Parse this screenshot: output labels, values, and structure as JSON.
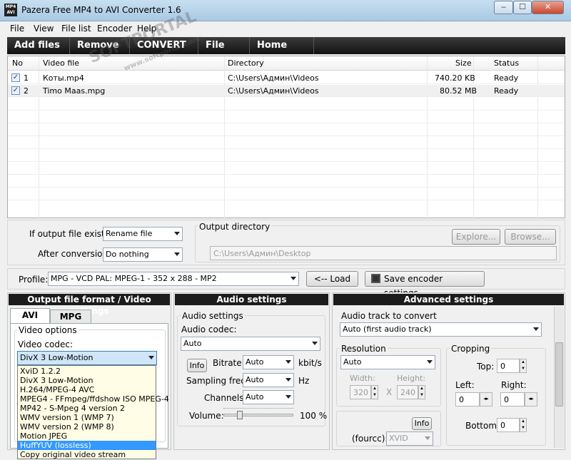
{
  "window": {
    "title": "Pazera Free MP4 to AVI Converter 1.6",
    "icon_text": "MP4 AVI",
    "controls": {
      "minimize": "–",
      "maximize": "☐",
      "close": "✕"
    }
  },
  "menu": [
    "File",
    "View",
    "File list",
    "Encoder",
    "Help"
  ],
  "toolbar": [
    "Add files",
    "Remove",
    "CONVERT",
    "File info",
    "Home page"
  ],
  "file_list": {
    "columns": [
      "No",
      "Video file",
      "Directory",
      "Size",
      "Status"
    ],
    "rows": [
      {
        "no": "1",
        "file": "Коты.mp4",
        "dir": "C:\\Users\\Админ\\Videos",
        "size": "740.20 KB",
        "status": "Ready",
        "checked": "✓"
      },
      {
        "no": "2",
        "file": "Timo Maas.mpg",
        "dir": "C:\\Users\\Админ\\Videos",
        "size": "80.52 MB",
        "status": "Ready",
        "checked": "✓"
      }
    ]
  },
  "options": {
    "if_exists_label": "If output file exists:",
    "if_exists_value": "Rename file",
    "after_conversion_label": "After conversion:",
    "after_conversion_value": "Do nothing",
    "output_dir_label": "Output directory",
    "output_dir_value": "C:\\Users\\Админ\\Desktop",
    "explore_label": "Explore...",
    "browse_label": "Browse..."
  },
  "profile": {
    "label": "Profile:",
    "value": "MPG - VCD PAL: MPEG-1 - 352 x 288 - MP2",
    "load_label": "<-- Load",
    "save_label": "Save encoder settings..."
  },
  "video_panel": {
    "header": "Output file format / Video settings",
    "tabs": [
      "AVI",
      "MPG"
    ],
    "group_label": "Video options",
    "codec_label": "Video codec:",
    "codec_value": "DivX 3 Low-Motion",
    "codec_options": [
      "XviD 1.2.2",
      "DivX 3 Low-Motion",
      "H.264/MPEG-4 AVC",
      "MPEG4 - FFmpeg/ffdshow ISO MPEG-4",
      "MP42 - S-Mpeg 4 version 2",
      "WMV version 1 (WMP 7)",
      "WMV version 2 (WMP 8)",
      "Motion JPEG",
      "HuffYUV (lossless)",
      "Copy original video stream"
    ],
    "highlighted_option": "HuffYUV (lossless)"
  },
  "audio_panel": {
    "header": "Audio settings",
    "group_label": "Audio settings",
    "codec_label": "Audio codec:",
    "codec_value": "Auto",
    "info_label": "Info",
    "bitrate_label": "Bitrate:",
    "bitrate_value": "Auto",
    "bitrate_unit": "kbit/s",
    "sampling_label": "Sampling freq.:",
    "sampling_value": "Auto",
    "sampling_unit": "Hz",
    "channels_label": "Channels:",
    "channels_value": "Auto",
    "volume_label": "Volume:",
    "volume_value": "100 %",
    "volume_level": 0.2
  },
  "advanced_panel": {
    "header": "Advanced settings",
    "audio_track_label": "Audio track to convert",
    "audio_track_value": "Auto (first audio track)",
    "resolution_label": "Resolution",
    "resolution_value": "Auto",
    "width_label": "Width:",
    "width_value": "320",
    "height_label": "Height:",
    "height_value": "240",
    "x_label": "X",
    "cropping_label": "Cropping",
    "top_label": "Top:",
    "top_value": "0",
    "left_label": "Left:",
    "left_value": "0",
    "right_label": "Right:",
    "right_value": "0",
    "bottom_label": "Bottom:",
    "bottom_value": "0",
    "info_label": "Info",
    "fourcc_label": "(fourcc):",
    "fourcc_value": "XVID"
  },
  "watermark": {
    "line1": "SOFTPORTAL",
    "line2": "www.softportal.com"
  }
}
